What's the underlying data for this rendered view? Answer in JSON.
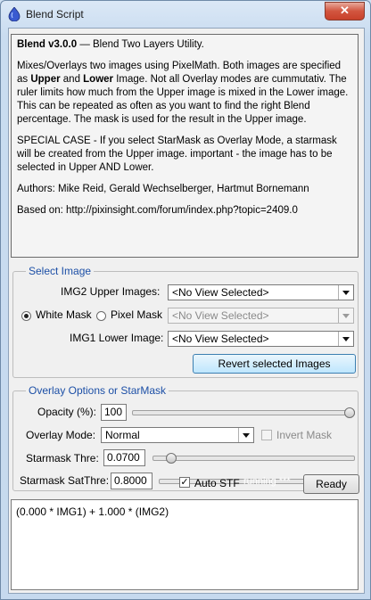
{
  "window": {
    "title": "Blend Script",
    "close_glyph": "✕"
  },
  "info": {
    "heading": "Blend v3.0.0",
    "heading_rest": " — Blend Two Layers Utility.",
    "p1_a": "Mixes/Overlays two images using PixelMath. Both images are specified as ",
    "p1_upper": "Upper",
    "p1_and": " and ",
    "p1_lower": "Lower",
    "p1_b": " Image. Not all Overlay modes are cummutativ. The ruler limits how much from the Upper image is mixed in the Lower image. This can be repeated as often as you want to find the right Blend percentage. The mask is used for the result in the Upper image.",
    "p2": "SPECIAL CASE - If you select StarMask as Overlay Mode, a starmask will be created from the Upper image. important - the image has to be selected in Upper AND Lower.",
    "p3": "Authors: Mike Reid, Gerald Wechselberger, Hartmut Bornemann",
    "p4": "Based on: http://pixinsight.com/forum/index.php?topic=2409.0"
  },
  "select_image": {
    "title": "Select Image",
    "upper_label": "IMG2 Upper Images:",
    "upper_value": "<No View Selected>",
    "white_mask_label": "White Mask",
    "pixel_mask_label": "Pixel Mask",
    "mask_selected": "white",
    "mask_value": "<No View Selected>",
    "lower_label": "IMG1 Lower Image:",
    "lower_value": "<No View Selected>",
    "revert_button": "Revert selected Images"
  },
  "overlay": {
    "title": "Overlay Options or StarMask",
    "opacity_label": "Opacity (%):",
    "opacity_value": "100",
    "opacity_level": 1.0,
    "mode_label": "Overlay Mode:",
    "mode_value": "Normal",
    "invert_mask_label": "Invert Mask",
    "invert_mask_checked": false,
    "starmask_thre_label": "Starmask Thre:",
    "starmask_thre_value": "0.0700",
    "starmask_thre_level": 0.07,
    "starmask_satthre_label": "Starmask SatThre:",
    "starmask_satthre_value": "0.8000",
    "starmask_satthre_level": 0.8
  },
  "footer": {
    "auto_stf_label": "Auto STF",
    "auto_stf_checked": true,
    "status_text": "running ***",
    "ready_button": "Ready"
  },
  "output": {
    "text": "(0.000 * IMG1) + 1.000 * (IMG2)"
  },
  "colors": {
    "group_title": "#1c4fa6",
    "title_icon": "#3a5bd0"
  }
}
